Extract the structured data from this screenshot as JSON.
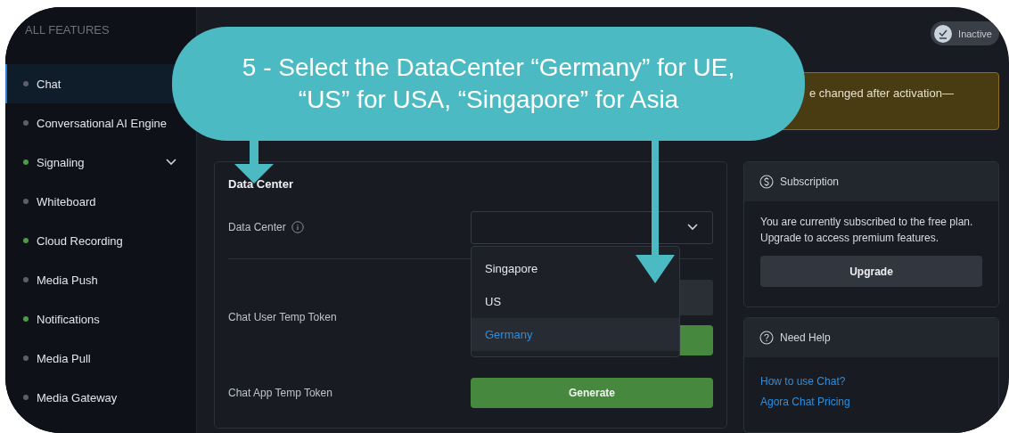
{
  "sidebar": {
    "heading": "ALL FEATURES",
    "items": [
      {
        "label": "Chat",
        "color": "#5c6068",
        "selected": true,
        "expandable": false
      },
      {
        "label": "Conversational AI Engine",
        "color": "#5c6068",
        "selected": false,
        "expandable": false
      },
      {
        "label": "Signaling",
        "color": "#4e9a45",
        "selected": false,
        "expandable": true
      },
      {
        "label": "Whiteboard",
        "color": "#5c6068",
        "selected": false,
        "expandable": false
      },
      {
        "label": "Cloud Recording",
        "color": "#4e9a45",
        "selected": false,
        "expandable": false
      },
      {
        "label": "Media Push",
        "color": "#5c6068",
        "selected": false,
        "expandable": false
      },
      {
        "label": "Notifications",
        "color": "#4e9a45",
        "selected": false,
        "expandable": false
      },
      {
        "label": "Media Pull",
        "color": "#5c6068",
        "selected": false,
        "expandable": false
      },
      {
        "label": "Media Gateway",
        "color": "#5c6068",
        "selected": false,
        "expandable": false
      }
    ]
  },
  "status_badge": {
    "label": "Inactive"
  },
  "notice": {
    "text": "e changed after activation—"
  },
  "data_center_card": {
    "title": "Data Center",
    "fields": [
      {
        "kind": "select",
        "label": "Data Center",
        "options": [
          {
            "label": "Singapore",
            "selected": false
          },
          {
            "label": "US",
            "selected": false
          },
          {
            "label": "Germany",
            "selected": true
          }
        ]
      },
      {
        "kind": "token",
        "label": "Chat User Temp Token"
      },
      {
        "kind": "generate",
        "label": "Chat App Temp Token",
        "button": "Generate"
      }
    ]
  },
  "subscription": {
    "title": "Subscription",
    "text": "You are currently subscribed to the free plan. Upgrade to access premium features.",
    "button": "Upgrade"
  },
  "help": {
    "title": "Need Help",
    "links": [
      "How to use Chat?",
      "Agora Chat Pricing"
    ]
  },
  "callout": {
    "lines": [
      "5 - Select the DataCenter “Germany” for UE,",
      "“US” for USA, “Singapore” for Asia"
    ]
  }
}
